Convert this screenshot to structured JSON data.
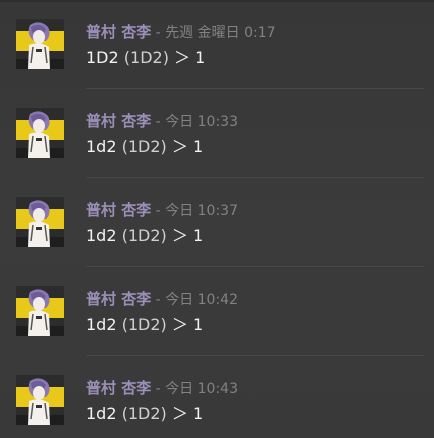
{
  "messages": [
    {
      "author": "普村 杏李",
      "sep": " - ",
      "time": "先週 金曜日 0:17",
      "cmd": "1D2",
      "paren": "(1D2)",
      "arrow": "＞",
      "result": "1"
    },
    {
      "author": "普村 杏李",
      "sep": " - ",
      "time": "今日 10:33",
      "cmd": "1d2",
      "paren": "(1D2)",
      "arrow": "＞",
      "result": "1"
    },
    {
      "author": "普村 杏李",
      "sep": " - ",
      "time": "今日 10:37",
      "cmd": "1d2",
      "paren": "(1D2)",
      "arrow": "＞",
      "result": "1"
    },
    {
      "author": "普村 杏李",
      "sep": " - ",
      "time": "今日 10:42",
      "cmd": "1d2",
      "paren": "(1D2)",
      "arrow": "＞",
      "result": "1"
    },
    {
      "author": "普村 杏李",
      "sep": " - ",
      "time": "今日 10:43",
      "cmd": "1d2",
      "paren": "(1D2)",
      "arrow": "＞",
      "result": "1"
    }
  ],
  "colors": {
    "background": "#3a3a3a",
    "author": "#9b8fb8",
    "timestamp": "#828282",
    "content": "#f2f2f2",
    "avatar_yellow": "#e8c818",
    "avatar_dark": "#2a2a2a"
  },
  "icons": {
    "avatar": "character-portrait-icon"
  }
}
